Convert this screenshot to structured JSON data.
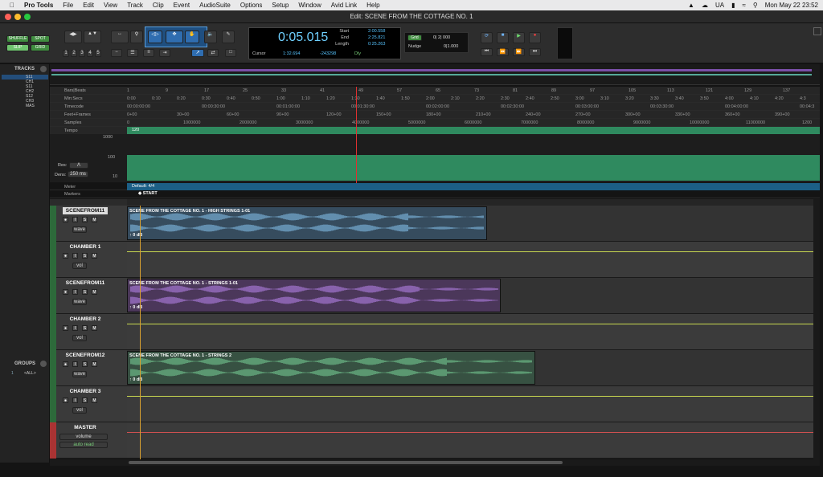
{
  "menubar": {
    "app": "Pro Tools",
    "items": [
      "File",
      "Edit",
      "View",
      "Track",
      "Clip",
      "Event",
      "AudioSuite",
      "Options",
      "Setup",
      "Window",
      "Avid Link",
      "Help"
    ],
    "locale": "UA",
    "datetime": "Mon May 22  23:52"
  },
  "window": {
    "title": "Edit: SCENE FROM THE COTTAGE NO. 1"
  },
  "toolbar": {
    "modes": [
      "SHUFFLE",
      "SPOT",
      "SLIP",
      "GRID"
    ],
    "zoom_presets": [
      "1",
      "2",
      "3",
      "4",
      "5"
    ],
    "main_counter": "0:05.015",
    "start_label": "Start",
    "end_label": "End",
    "length_label": "Length",
    "start": "2:00.558",
    "end": "2:25.821",
    "length": "0:25.263",
    "cursor_label": "Cursor",
    "cursor": "1:32.694",
    "cursor_samples": "-243298",
    "dly": "Dly",
    "grid_label": "Grid",
    "grid_value": "0| 2| 000",
    "nudge_label": "Nudge",
    "nudge_value": "0|1.000"
  },
  "sidebar": {
    "tracks_title": "TRACKS",
    "tracks": [
      "S11",
      "CH1",
      "S11",
      "CH2",
      "S12",
      "CH3",
      "MAS"
    ],
    "groups_title": "GROUPS",
    "groups": [
      "1",
      "<ALL>"
    ]
  },
  "rulers": {
    "rows": [
      "Bars|Beats",
      "Min:Secs",
      "Timecode",
      "Feet+Frames",
      "Samples",
      "Tempo"
    ],
    "bars": [
      "1",
      "9",
      "17",
      "25",
      "33",
      "41",
      "49",
      "57",
      "65",
      "73",
      "81",
      "89",
      "97",
      "105",
      "113",
      "121",
      "129",
      "137"
    ],
    "minsecs": [
      "0:00",
      "0:10",
      "0:20",
      "0:30",
      "0:40",
      "0:50",
      "1:00",
      "1:10",
      "1:20",
      "1:30",
      "1:40",
      "1:50",
      "2:00",
      "2:10",
      "2:20",
      "2:30",
      "2:40",
      "2:50",
      "3:00",
      "3:10",
      "3:20",
      "3:30",
      "3:40",
      "3:50",
      "4:00",
      "4:10",
      "4:20",
      "4:3"
    ],
    "timecode": [
      "00:00:00:00",
      "00:00:30:00",
      "00:01:00:00",
      "00:01:30:00",
      "00:02:00:00",
      "00:02:30:00",
      "00:03:00:00",
      "00:03:30:00",
      "00:04:00:00",
      "00:04:3"
    ],
    "feet": [
      "0+00",
      "30+00",
      "60+00",
      "90+00",
      "120+00",
      "150+00",
      "180+00",
      "210+00",
      "240+00",
      "270+00",
      "300+00",
      "330+00",
      "360+00",
      "390+00"
    ],
    "samples": [
      "0",
      "1000000",
      "2000000",
      "3000000",
      "4000000",
      "5000000",
      "6000000",
      "7000000",
      "8000000",
      "9000000",
      "10000000",
      "11000000",
      "1200"
    ],
    "tempo": "120",
    "tempo_scale": [
      "1000",
      "100",
      "10"
    ],
    "res_label": "Res:",
    "dens_label": "Dens:",
    "dens_value": "250 ms",
    "meter_label": "Meter",
    "meter_value": "Default: 4/4",
    "markers_label": "Markers",
    "marker": "START"
  },
  "tracks": [
    {
      "name": "SCENEFROM11",
      "type": "audio",
      "view": "wave",
      "clip": "SCENE FROM THE COTTAGE NO. 1 - HIGH STRINGS 1-01",
      "gain": "0 dB",
      "color": "#3b7fb5"
    },
    {
      "name": "CHAMBER 1",
      "type": "aux",
      "view": "vol"
    },
    {
      "name": "SCENEFROM11",
      "type": "audio",
      "view": "wave",
      "clip": "SCENE FROM THE COTTAGE NO. 1 - STRINGS 1-01",
      "gain": "0 dB",
      "color": "#7a3fa8"
    },
    {
      "name": "CHAMBER 2",
      "type": "aux",
      "view": "vol"
    },
    {
      "name": "SCENEFROM12",
      "type": "audio",
      "view": "wave",
      "clip": "SCENE FROM THE COTTAGE NO. 1 - STRINGS 2",
      "gain": "0 dB",
      "color": "#3f8c5f"
    },
    {
      "name": "CHAMBER 3",
      "type": "aux",
      "view": "vol"
    },
    {
      "name": "MASTER",
      "type": "master",
      "view": "volume",
      "mode": "auto read"
    }
  ],
  "buttons": {
    "s": "S",
    "m": "M",
    "i": "I"
  }
}
